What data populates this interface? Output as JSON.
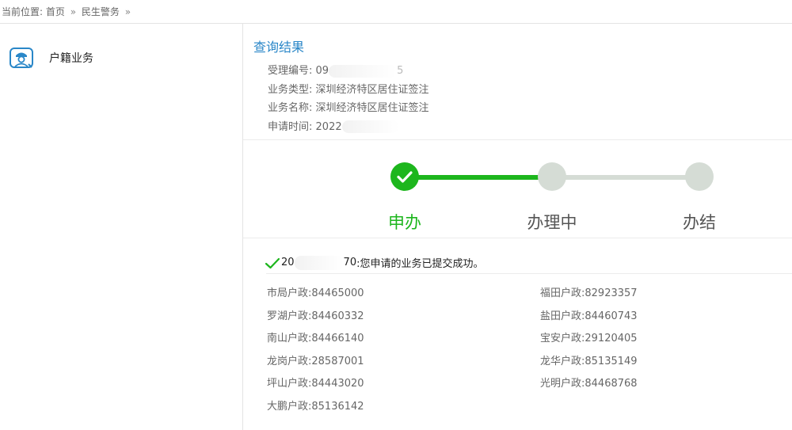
{
  "breadcrumb": {
    "prefix": "当前位置:",
    "home": "首页",
    "separator": "»",
    "section": "民生警务"
  },
  "sidebar": {
    "items": [
      {
        "label": "户籍业务",
        "icon": "police-officer-icon"
      }
    ]
  },
  "result": {
    "title": "查询结果",
    "fields": [
      {
        "label": "受理编号:",
        "value_prefix": "09",
        "value_suffix": "5"
      },
      {
        "label": "业务类型:",
        "value": "深圳经济特区居住证签注"
      },
      {
        "label": "业务名称:",
        "value": "深圳经济特区居住证签注"
      },
      {
        "label": "申请时间:",
        "value_prefix": "2022",
        "value_suffix": ""
      }
    ]
  },
  "progress": {
    "steps": [
      {
        "label": "申办",
        "status": "done"
      },
      {
        "label": "办理中",
        "status": "pending"
      },
      {
        "label": "办结",
        "status": "pending"
      }
    ],
    "fraction_complete": 0.5,
    "colors": {
      "active": "#1db61d",
      "inactive": "#d5dcd5",
      "active_text": "#1db61d"
    }
  },
  "notice": {
    "id_prefix": "20",
    "id_suffix": "70",
    "message": ":您申请的业务已提交成功。"
  },
  "contacts": {
    "left": [
      {
        "label": "市局户政:",
        "phone": "84465000"
      },
      {
        "label": "罗湖户政:",
        "phone": "84460332"
      },
      {
        "label": "南山户政:",
        "phone": "84466140"
      },
      {
        "label": "龙岗户政:",
        "phone": "28587001"
      },
      {
        "label": "坪山户政:",
        "phone": "84443020"
      },
      {
        "label": "大鹏户政:",
        "phone": "85136142"
      }
    ],
    "right": [
      {
        "label": "福田户政:",
        "phone": "82923357"
      },
      {
        "label": "盐田户政:",
        "phone": "84460743"
      },
      {
        "label": "宝安户政:",
        "phone": "29120405"
      },
      {
        "label": "龙华户政:",
        "phone": "85135149"
      },
      {
        "label": "光明户政:",
        "phone": "84468768"
      }
    ]
  }
}
